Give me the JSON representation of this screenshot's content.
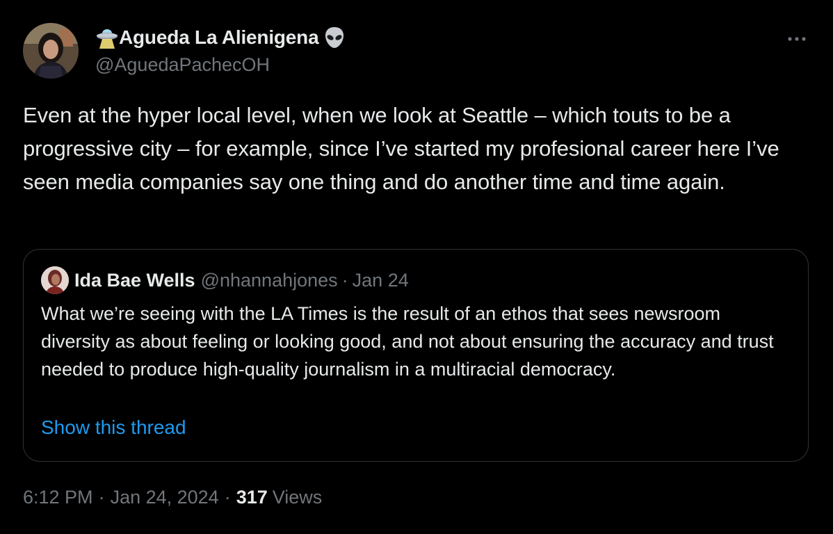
{
  "author": {
    "name": "Agueda La Alienigena",
    "handle": "@AguedaPachecOH",
    "name_prefix_icon": "ufo-emoji",
    "name_suffix_icon": "alien-emoji"
  },
  "tweet": {
    "text": "Even at the hyper local level, when we look at Seattle – which touts to be a progressive city – for example, since I’ve started my profesional career here I’ve seen media companies say one thing and do another time and time again."
  },
  "quoted_tweet": {
    "author_name": "Ida Bae Wells",
    "handle": "@nhannahjones",
    "date": "Jan 24",
    "separator": "·",
    "text": "What we’re seeing with the LA Times is the result of an ethos that sees newsroom diversity as about feeling or looking good, and not about ensuring the accuracy and trust needed to produce high-quality journalism in a multiracial democracy.",
    "show_thread_label": "Show this thread"
  },
  "footer": {
    "time": "6:12 PM",
    "date": "Jan 24, 2024",
    "separator": "·",
    "views_count": "317",
    "views_label": "Views"
  },
  "colors": {
    "background": "#000000",
    "text_primary": "#e7e9ea",
    "text_secondary": "#71767b",
    "link": "#1d9bf0",
    "border": "#2f3336"
  }
}
